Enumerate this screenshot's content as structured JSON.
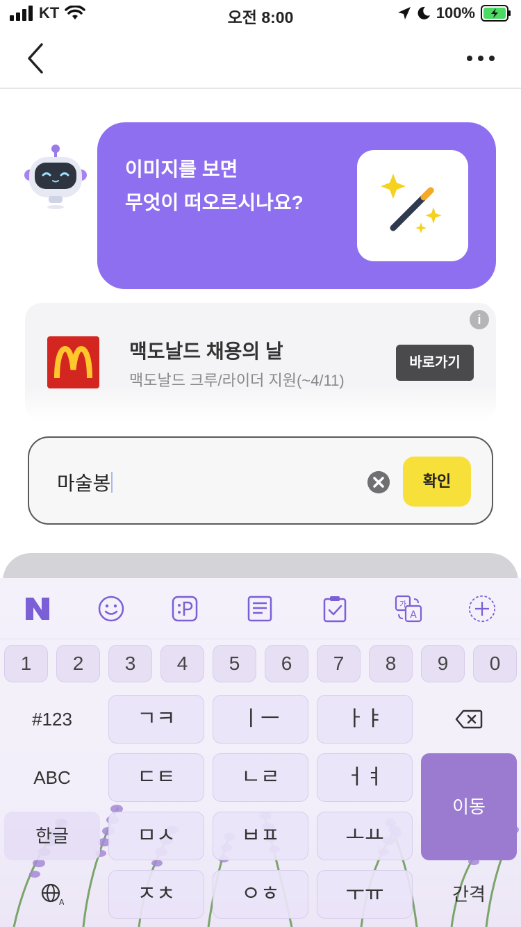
{
  "status_bar": {
    "carrier": "KT",
    "time": "오전 8:00",
    "battery": "100%"
  },
  "nav": {
    "back_icon": "chevron-left-icon",
    "more_icon": "more-horizontal-icon"
  },
  "bubble": {
    "line1": "이미지를 보면",
    "line2": "무엇이 떠오르시나요?",
    "image_icon": "magic-wand-icon"
  },
  "ad": {
    "title": "맥도날드 채용의 날",
    "subtitle": "맥도날드 크루/라이더 지원(~4/11)",
    "button": "바로가기",
    "info_icon": "i"
  },
  "input": {
    "value": "마술봉",
    "confirm": "확인"
  },
  "keyboard": {
    "toolbar_icons": [
      "naver-n-icon",
      "emoji-icon",
      "sticker-icon",
      "memo-icon",
      "clipboard-icon",
      "translate-icon",
      "add-icon"
    ],
    "numbers": [
      "1",
      "2",
      "3",
      "4",
      "5",
      "6",
      "7",
      "8",
      "9",
      "0"
    ],
    "row1": {
      "left": "#123",
      "k1": "ㄱㅋ",
      "k2": "ㅣㅡ",
      "k3": "ㅏㅑ"
    },
    "row2": {
      "left": "ABC",
      "k1": "ㄷㅌ",
      "k2": "ㄴㄹ",
      "k3": "ㅓㅕ"
    },
    "row3": {
      "left": "한글",
      "k1": "ㅁㅅ",
      "k2": "ㅂㅍ",
      "k3": "ㅗㅛ"
    },
    "row4": {
      "k1": "ㅈㅊ",
      "k2": "ㅇㅎ",
      "k3": "ㅜㅠ"
    },
    "enter": "이동",
    "space": "간격",
    "accent": "#9b7bd0"
  }
}
